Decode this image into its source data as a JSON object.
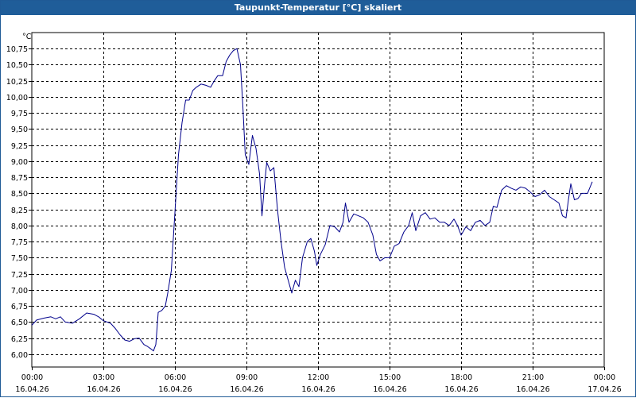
{
  "window": {
    "title": "Taupunkt-Temperatur [°C] skaliert"
  },
  "chart_data": {
    "type": "line",
    "title": "Taupunkt-Temperatur [°C] skaliert",
    "ylabel": "°C",
    "xlabel": "",
    "ylim": [
      5.8,
      11.0
    ],
    "xlim": [
      0,
      24
    ],
    "grid": true,
    "y_ticks": [
      "6,00",
      "6,25",
      "6,50",
      "6,75",
      "7,00",
      "7,25",
      "7,50",
      "7,75",
      "8,00",
      "8,25",
      "8,50",
      "8,75",
      "9,00",
      "9,25",
      "9,50",
      "9,75",
      "10,00",
      "10,25",
      "10,50",
      "10,75"
    ],
    "x_ticks": [
      {
        "time": "00:00",
        "date": "16.04.26"
      },
      {
        "time": "03:00",
        "date": "16.04.26"
      },
      {
        "time": "06:00",
        "date": "16.04.26"
      },
      {
        "time": "09:00",
        "date": "16.04.26"
      },
      {
        "time": "12:00",
        "date": "16.04.26"
      },
      {
        "time": "15:00",
        "date": "16.04.26"
      },
      {
        "time": "18:00",
        "date": "16.04.26"
      },
      {
        "time": "21:00",
        "date": "16.04.26"
      },
      {
        "time": "00:00",
        "date": "17.04.26"
      }
    ],
    "series": [
      {
        "color": "#00008b",
        "points": [
          [
            0.0,
            6.45
          ],
          [
            0.2,
            6.53
          ],
          [
            0.5,
            6.56
          ],
          [
            0.8,
            6.58
          ],
          [
            1.0,
            6.55
          ],
          [
            1.2,
            6.58
          ],
          [
            1.4,
            6.5
          ],
          [
            1.7,
            6.48
          ],
          [
            2.0,
            6.55
          ],
          [
            2.3,
            6.64
          ],
          [
            2.6,
            6.62
          ],
          [
            2.8,
            6.58
          ],
          [
            3.0,
            6.52
          ],
          [
            3.3,
            6.48
          ],
          [
            3.5,
            6.4
          ],
          [
            3.7,
            6.3
          ],
          [
            3.9,
            6.22
          ],
          [
            4.1,
            6.2
          ],
          [
            4.3,
            6.24
          ],
          [
            4.5,
            6.25
          ],
          [
            4.7,
            6.15
          ],
          [
            4.85,
            6.12
          ],
          [
            5.0,
            6.08
          ],
          [
            5.1,
            6.05
          ],
          [
            5.2,
            6.15
          ],
          [
            5.3,
            6.65
          ],
          [
            5.45,
            6.68
          ],
          [
            5.6,
            6.75
          ],
          [
            5.7,
            6.95
          ],
          [
            5.85,
            7.3
          ],
          [
            5.95,
            7.9
          ],
          [
            6.05,
            8.5
          ],
          [
            6.15,
            9.1
          ],
          [
            6.3,
            9.6
          ],
          [
            6.45,
            9.95
          ],
          [
            6.6,
            9.95
          ],
          [
            6.75,
            10.1
          ],
          [
            6.9,
            10.15
          ],
          [
            7.1,
            10.2
          ],
          [
            7.3,
            10.18
          ],
          [
            7.5,
            10.15
          ],
          [
            7.65,
            10.25
          ],
          [
            7.8,
            10.33
          ],
          [
            8.0,
            10.33
          ],
          [
            8.15,
            10.55
          ],
          [
            8.3,
            10.65
          ],
          [
            8.45,
            10.72
          ],
          [
            8.6,
            10.75
          ],
          [
            8.75,
            10.5
          ],
          [
            8.85,
            9.85
          ],
          [
            8.95,
            9.1
          ],
          [
            9.1,
            8.95
          ],
          [
            9.25,
            9.4
          ],
          [
            9.4,
            9.2
          ],
          [
            9.55,
            8.8
          ],
          [
            9.65,
            8.15
          ],
          [
            9.75,
            8.6
          ],
          [
            9.85,
            8.98
          ],
          [
            10.0,
            8.85
          ],
          [
            10.15,
            8.9
          ],
          [
            10.3,
            8.25
          ],
          [
            10.45,
            7.75
          ],
          [
            10.6,
            7.35
          ],
          [
            10.75,
            7.15
          ],
          [
            10.9,
            6.95
          ],
          [
            11.05,
            7.15
          ],
          [
            11.2,
            7.05
          ],
          [
            11.35,
            7.5
          ],
          [
            11.55,
            7.75
          ],
          [
            11.7,
            7.8
          ],
          [
            11.85,
            7.6
          ],
          [
            11.95,
            7.38
          ],
          [
            12.1,
            7.55
          ],
          [
            12.3,
            7.7
          ],
          [
            12.5,
            8.0
          ],
          [
            12.7,
            7.98
          ],
          [
            12.9,
            7.9
          ],
          [
            13.05,
            8.05
          ],
          [
            13.15,
            8.35
          ],
          [
            13.3,
            8.05
          ],
          [
            13.5,
            8.18
          ],
          [
            13.7,
            8.15
          ],
          [
            13.9,
            8.12
          ],
          [
            14.1,
            8.05
          ],
          [
            14.3,
            7.85
          ],
          [
            14.45,
            7.55
          ],
          [
            14.6,
            7.45
          ],
          [
            14.8,
            7.5
          ],
          [
            15.0,
            7.5
          ],
          [
            15.2,
            7.68
          ],
          [
            15.4,
            7.72
          ],
          [
            15.6,
            7.9
          ],
          [
            15.8,
            8.0
          ],
          [
            15.95,
            8.2
          ],
          [
            16.1,
            7.92
          ],
          [
            16.3,
            8.15
          ],
          [
            16.5,
            8.2
          ],
          [
            16.7,
            8.1
          ],
          [
            16.9,
            8.12
          ],
          [
            17.1,
            8.05
          ],
          [
            17.3,
            8.05
          ],
          [
            17.5,
            8.0
          ],
          [
            17.7,
            8.1
          ],
          [
            17.85,
            8.0
          ],
          [
            18.0,
            7.85
          ],
          [
            18.2,
            7.98
          ],
          [
            18.4,
            7.92
          ],
          [
            18.6,
            8.05
          ],
          [
            18.8,
            8.08
          ],
          [
            19.0,
            8.0
          ],
          [
            19.2,
            8.05
          ],
          [
            19.35,
            8.3
          ],
          [
            19.5,
            8.28
          ],
          [
            19.7,
            8.55
          ],
          [
            19.9,
            8.62
          ],
          [
            20.1,
            8.58
          ],
          [
            20.3,
            8.55
          ],
          [
            20.5,
            8.6
          ],
          [
            20.7,
            8.58
          ],
          [
            20.9,
            8.52
          ],
          [
            21.1,
            8.45
          ],
          [
            21.3,
            8.48
          ],
          [
            21.5,
            8.55
          ],
          [
            21.7,
            8.45
          ],
          [
            21.9,
            8.4
          ],
          [
            22.1,
            8.35
          ],
          [
            22.25,
            8.15
          ],
          [
            22.4,
            8.12
          ],
          [
            22.5,
            8.4
          ],
          [
            22.6,
            8.65
          ],
          [
            22.75,
            8.4
          ],
          [
            22.9,
            8.42
          ],
          [
            23.05,
            8.5
          ],
          [
            23.3,
            8.5
          ],
          [
            23.5,
            8.68
          ]
        ]
      }
    ]
  }
}
